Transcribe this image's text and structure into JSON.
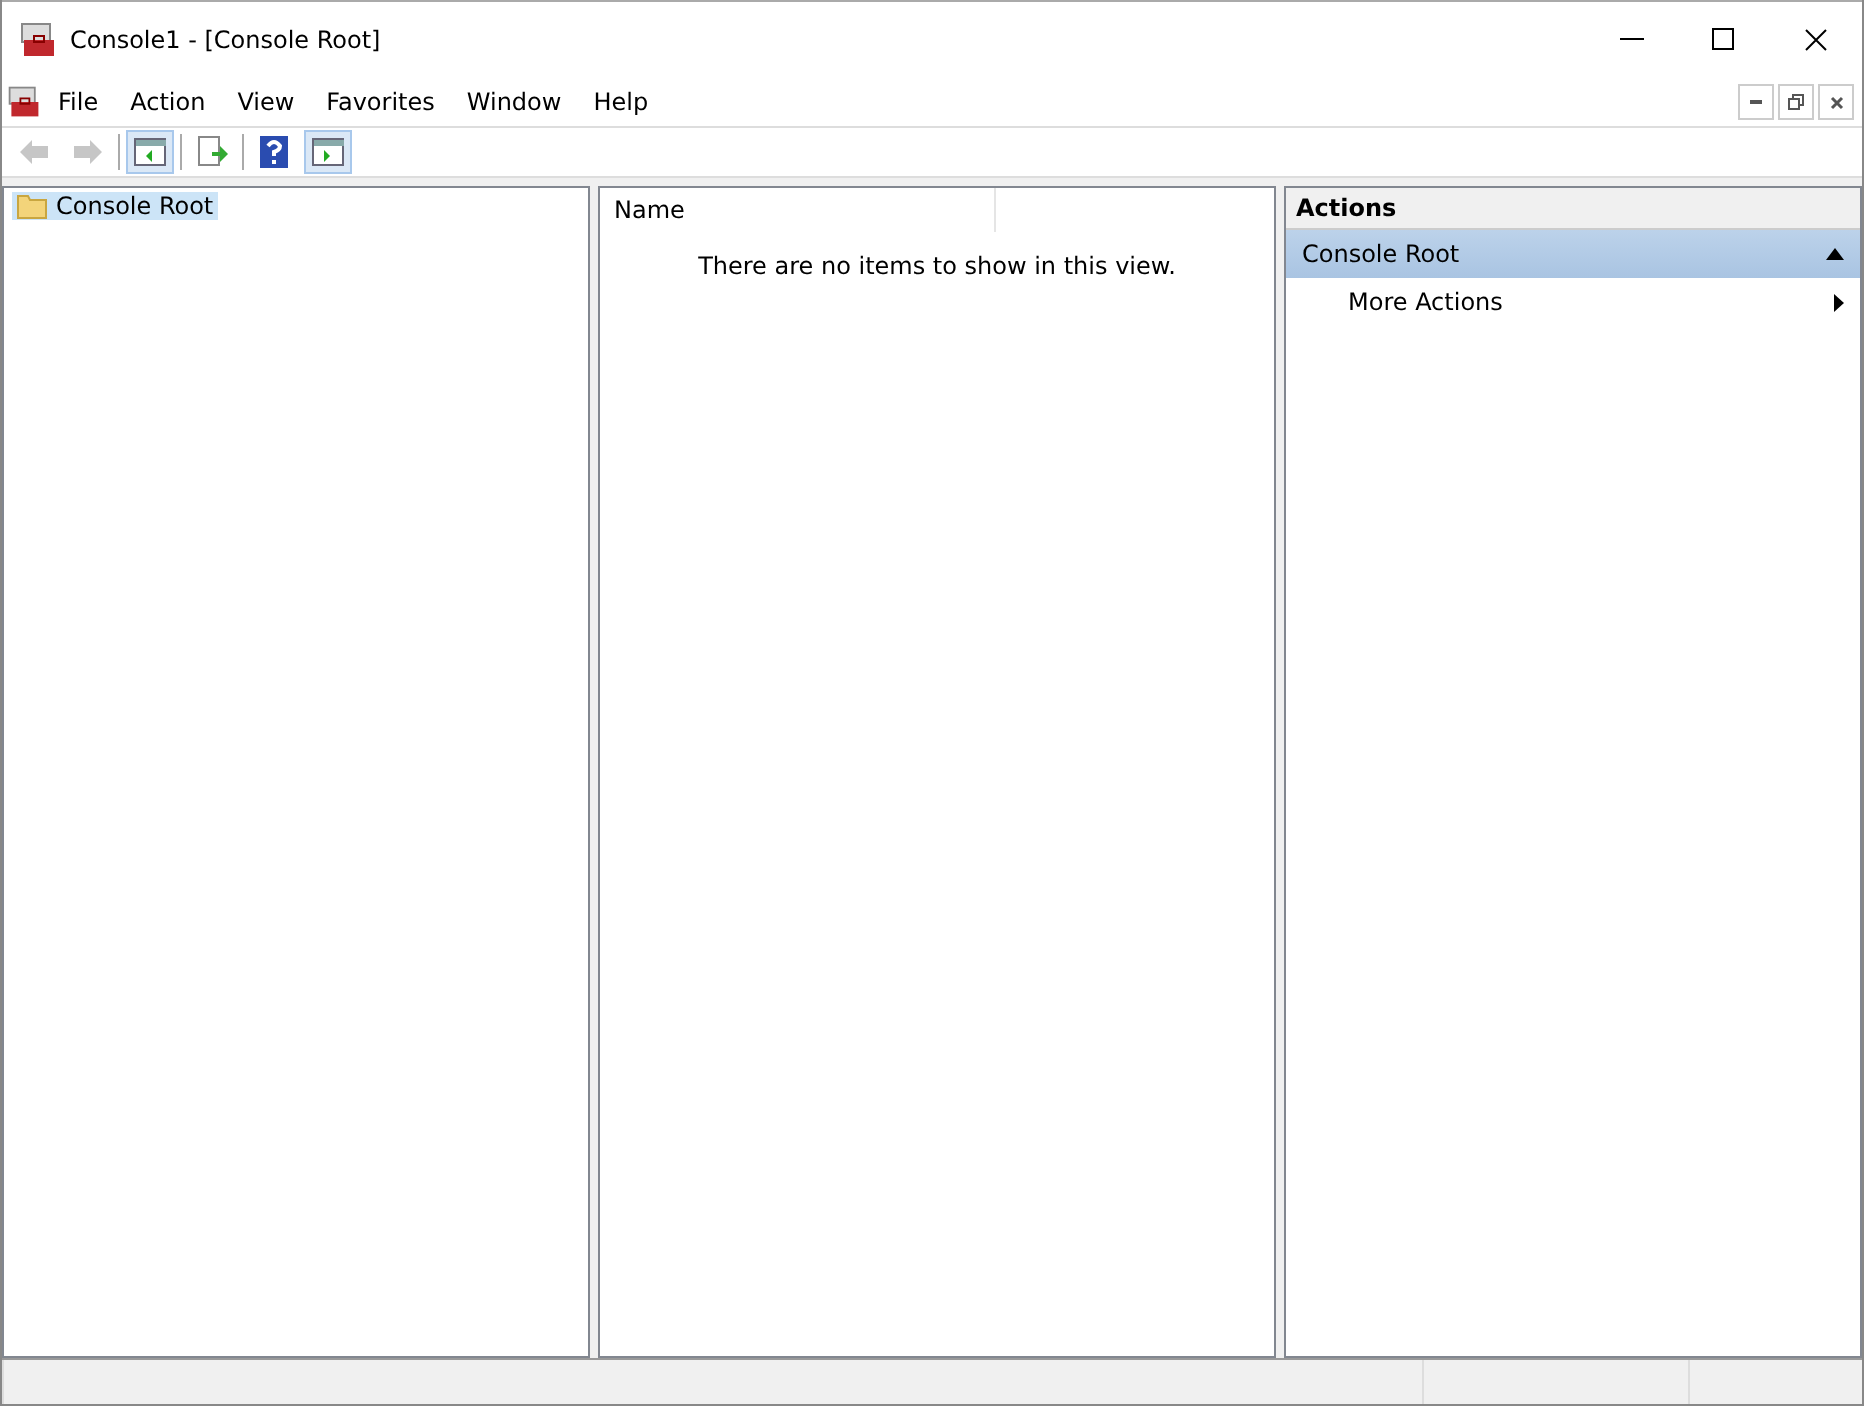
{
  "window": {
    "title": "Console1 - [Console Root]"
  },
  "menu": [
    "File",
    "Action",
    "View",
    "Favorites",
    "Window",
    "Help"
  ],
  "toolbar": [
    {
      "kind": "back",
      "disabled": true,
      "selected": false
    },
    {
      "kind": "forward",
      "disabled": true,
      "selected": false
    },
    {
      "kind": "tree",
      "disabled": false,
      "selected": true
    },
    {
      "kind": "export",
      "disabled": false,
      "selected": false
    },
    {
      "kind": "help",
      "disabled": false,
      "selected": false
    },
    {
      "kind": "actionpane",
      "disabled": false,
      "selected": true
    }
  ],
  "tree": {
    "items": [
      {
        "label": "Console Root",
        "selected": true
      }
    ]
  },
  "list": {
    "columns": [
      "Name"
    ],
    "empty_message": "There are no items to show in this view."
  },
  "actions": {
    "title": "Actions",
    "sections": [
      {
        "title": "Console Root",
        "expanded": true,
        "items": [
          {
            "label": "More Actions"
          }
        ]
      }
    ]
  }
}
